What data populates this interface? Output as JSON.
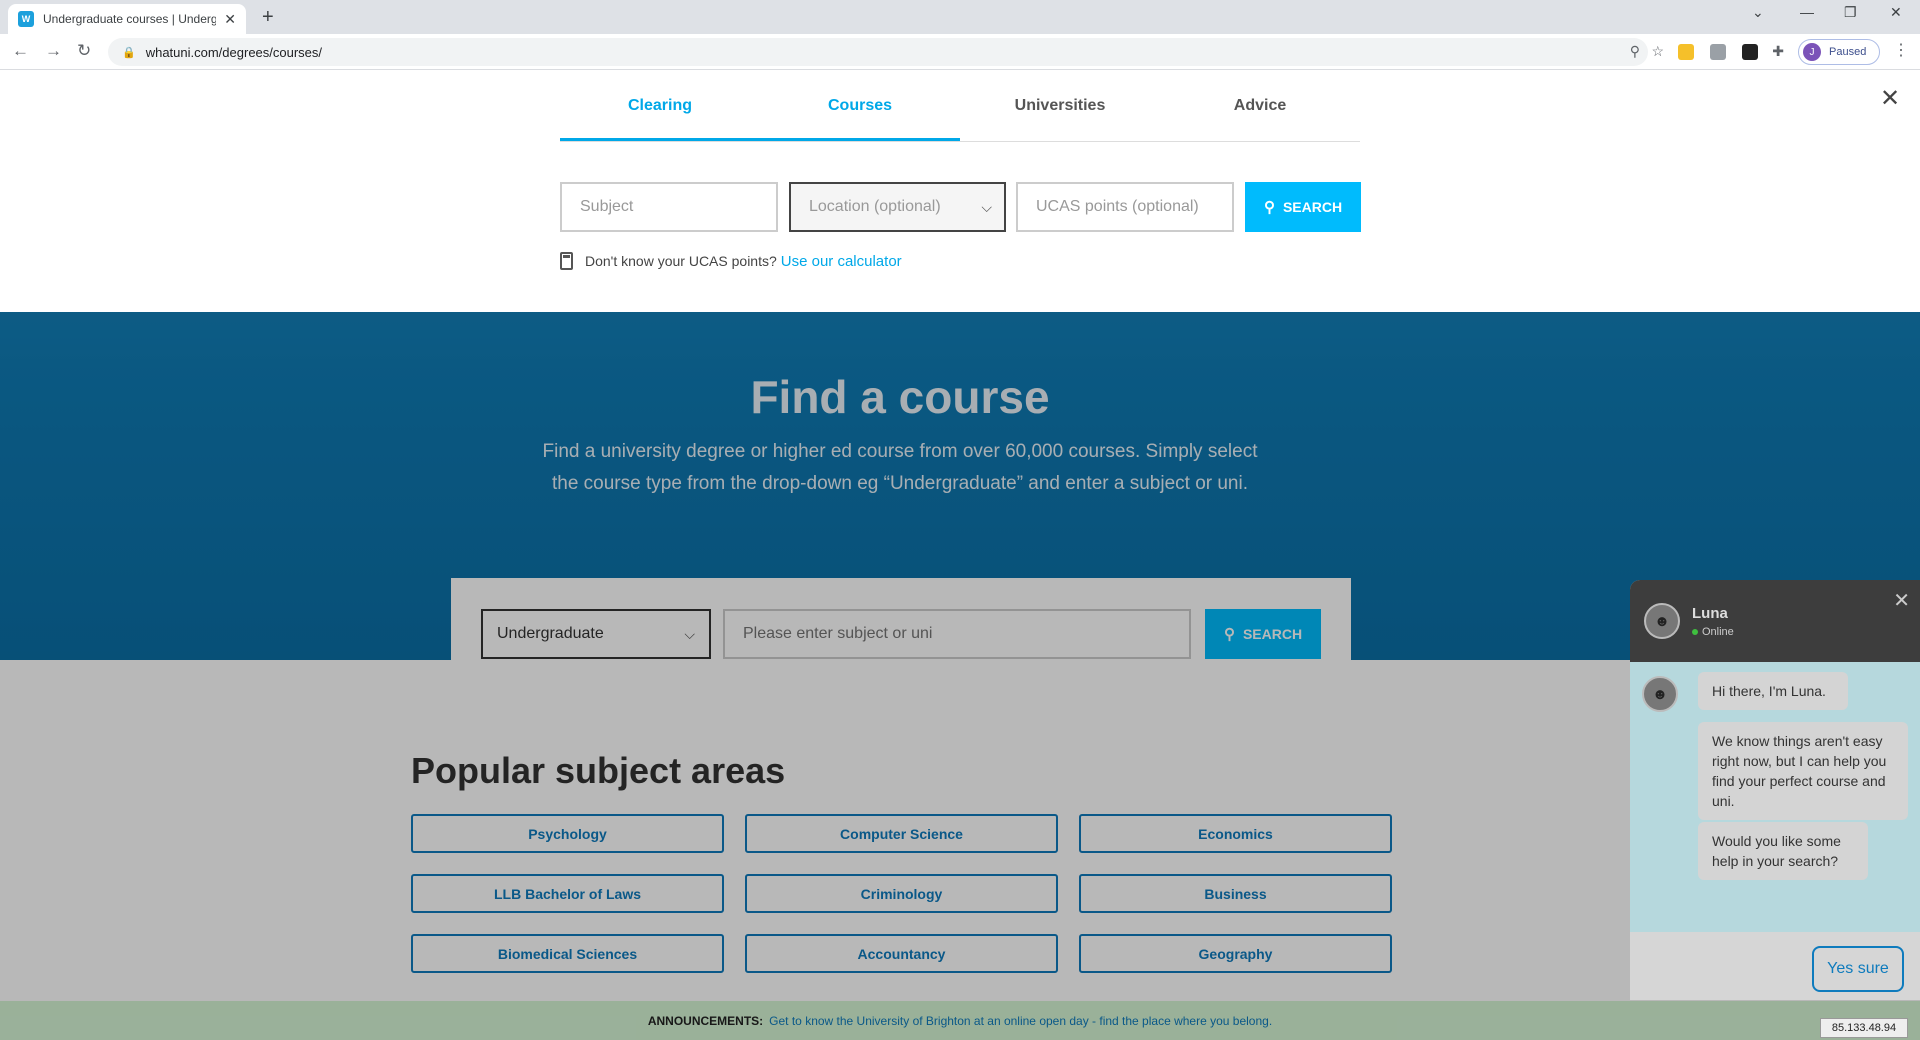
{
  "browser": {
    "tab_title": "Undergraduate courses | Underg",
    "favicon_text": "W",
    "url": "whatuni.com/degrees/courses/",
    "profile_initial": "J",
    "profile_status": "Paused"
  },
  "panel": {
    "tabs": [
      {
        "label": "Clearing"
      },
      {
        "label": "Courses"
      },
      {
        "label": "Universities"
      },
      {
        "label": "Advice"
      }
    ],
    "subject_placeholder": "Subject",
    "location_placeholder": "Location (optional)",
    "ucas_placeholder": "UCAS points (optional)",
    "search_label": "SEARCH",
    "calc_text": "Don't know your UCAS points?",
    "calc_link": "Use our calculator"
  },
  "hero": {
    "title": "Find a course",
    "subtitle": "Find a university degree or higher ed course from over 60,000 courses. Simply select the course type from the drop-down eg “Undergraduate” and enter a subject or uni.",
    "course_type": "Undergraduate",
    "input_placeholder": "Please enter subject or uni",
    "search_label": "SEARCH"
  },
  "popular": {
    "title": "Popular subject areas",
    "subjects": [
      "Psychology",
      "Computer Science",
      "Economics",
      "LLB Bachelor of Laws",
      "Criminology",
      "Business",
      "Biomedical Sciences",
      "Accountancy",
      "Geography"
    ]
  },
  "announcement": {
    "label": "ANNOUNCEMENTS:",
    "text": "Get to know the University of Brighton at an online open day - find the place where you belong."
  },
  "ip_badge": "85.133.48.94",
  "chat": {
    "name": "Luna",
    "status": "Online",
    "messages": [
      "Hi there, I'm Luna.",
      "We know things aren't easy right now, but I can help you find your perfect course and uni.",
      "Would you like some help in your search?"
    ],
    "reply_button": "Yes sure"
  },
  "colors": {
    "accent": "#00a8e8",
    "button": "#00bbfd",
    "link_blue": "#0e7bbd",
    "hero_blue": "#1b8fc9",
    "announce_bg": "#d6f5d5"
  }
}
